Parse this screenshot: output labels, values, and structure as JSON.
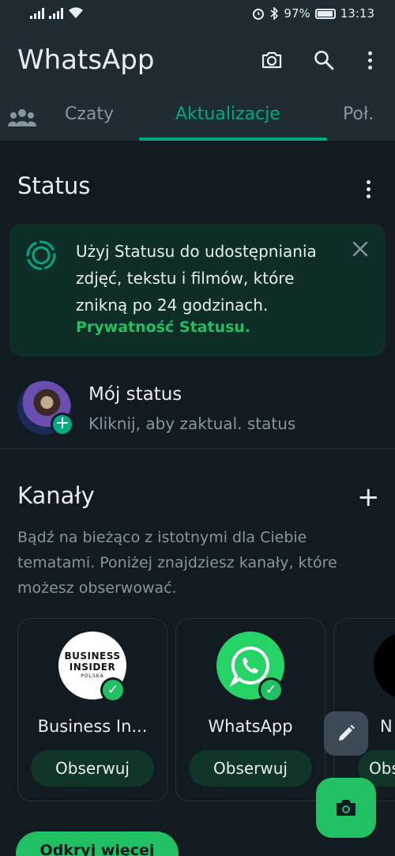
{
  "statusbar": {
    "battery": "97%",
    "time": "13:13",
    "battery_level": 0.97
  },
  "header": {
    "title": "WhatsApp",
    "icons": [
      "camera-icon",
      "search-icon",
      "more-icon"
    ]
  },
  "tabs": {
    "chats": "Czaty",
    "updates": "Aktualizacje",
    "calls": "Poł."
  },
  "status": {
    "title": "Status",
    "banner_text": "Użyj Statusu do udostępniania zdjęć, tekstu i filmów, które znikną po 24 godzinach.",
    "banner_link": "Prywatność Statusu.",
    "my_status_name": "Mój status",
    "my_status_sub": "Kliknij, aby zaktual. status"
  },
  "channels": {
    "title": "Kanały",
    "description": "Bądź na bieżąco z istotnymi dla Ciebie tematami. Poniżej znajdziesz kanały, które możesz obserwować.",
    "cards": [
      {
        "name": "Business In...",
        "follow": "Obserwuj",
        "logo_l1": "BUSINESS",
        "logo_l2": "INSIDER",
        "logo_l3": "POLSKA"
      },
      {
        "name": "WhatsApp",
        "follow": "Obserwuj"
      },
      {
        "name": "N",
        "follow": "Obs"
      }
    ],
    "discover": "Odkryj więcej"
  },
  "colors": {
    "accent": "#00a884",
    "background": "#111b21",
    "header": "#1f2c34",
    "banner": "#0f2e27"
  }
}
